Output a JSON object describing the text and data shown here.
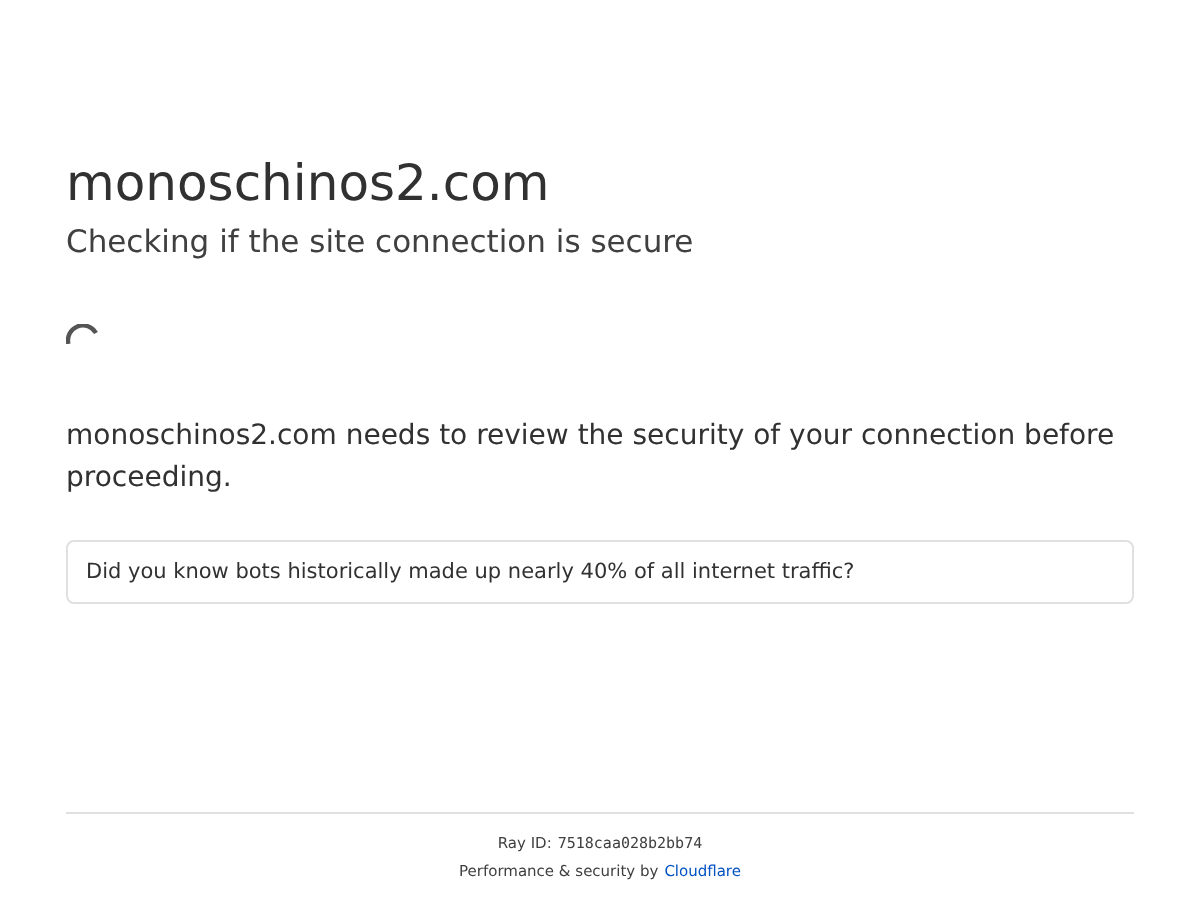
{
  "heading": "monoschinos2.com",
  "subheading": "Checking if the site connection is secure",
  "message": "monoschinos2.com needs to review the security of your connection before proceeding.",
  "tip": "Did you know bots historically made up nearly 40% of all internet traffic?",
  "footer": {
    "ray_label": "Ray ID:",
    "ray_id": "7518caa028b2bb74",
    "credit": "Performance & security by",
    "link": "Cloudflare"
  }
}
